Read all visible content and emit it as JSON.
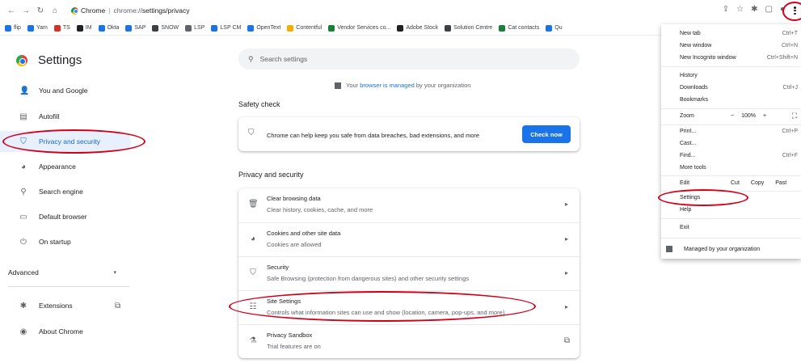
{
  "browser": {
    "tab_title": "Chrome",
    "url_host": "chrome://",
    "url_path": "settings/privacy",
    "icons": [
      "back-icon",
      "forward-icon",
      "reload-icon",
      "home-icon",
      "share-icon",
      "star-icon",
      "extensions-icon",
      "sidepanel-icon",
      "profile-icon",
      "kebab-icon"
    ]
  },
  "bookmarks": [
    {
      "label": "flip",
      "color": "#1a73e8"
    },
    {
      "label": "Yam",
      "color": "#1a73e8"
    },
    {
      "label": "TS",
      "color": "#d93025"
    },
    {
      "label": "IM",
      "color": "#202124"
    },
    {
      "label": "Okta",
      "color": "#1a73e8"
    },
    {
      "label": "SAP",
      "color": "#1a73e8"
    },
    {
      "label": "SNOW",
      "color": "#3c4043"
    },
    {
      "label": "LSP",
      "color": "#5f6368"
    },
    {
      "label": "LSP CM",
      "color": "#1a73e8"
    },
    {
      "label": "OpenText",
      "color": "#1a73e8"
    },
    {
      "label": "Contentful",
      "color": "#f9ab00"
    },
    {
      "label": "Vendor Services co...",
      "color": "#188038"
    },
    {
      "label": "Adobe Stock",
      "color": "#202124"
    },
    {
      "label": "Solution Centre",
      "color": "#3c4043"
    },
    {
      "label": "Cat contacts",
      "color": "#188038"
    },
    {
      "label": "Qu",
      "color": "#1a73e8"
    }
  ],
  "settings": {
    "title": "Settings",
    "nav": [
      {
        "label": "You and Google",
        "icon": "person-icon"
      },
      {
        "label": "Autofill",
        "icon": "clipboard-icon"
      },
      {
        "label": "Privacy and security",
        "icon": "shield-icon",
        "active": true
      },
      {
        "label": "Appearance",
        "icon": "palette-icon"
      },
      {
        "label": "Search engine",
        "icon": "search-icon"
      },
      {
        "label": "Default browser",
        "icon": "browser-icon"
      },
      {
        "label": "On startup",
        "icon": "power-icon"
      }
    ],
    "advanced": "Advanced",
    "extensions": "Extensions",
    "about": "About Chrome"
  },
  "main": {
    "search_placeholder": "Search settings",
    "managed_prefix": "Your",
    "managed_link": "browser is managed",
    "managed_suffix": "by your organization",
    "safety_title": "Safety check",
    "safety_text": "Chrome can help keep you safe from data breaches, bad extensions, and more",
    "check_now": "Check now",
    "privacy_title": "Privacy and security",
    "rows": [
      {
        "title": "Clear browsing data",
        "sub": "Clear history, cookies, cache, and more",
        "icon": "trash-icon"
      },
      {
        "title": "Cookies and other site data",
        "sub": "Cookies are allowed",
        "icon": "cookie-icon"
      },
      {
        "title": "Security",
        "sub": "Safe Browsing (protection from dangerous sites) and other security settings",
        "icon": "shield-icon"
      },
      {
        "title": "Site Settings",
        "sub": "Controls what information sites can use and show (location, camera, pop-ups, and more)",
        "icon": "sliders-icon"
      },
      {
        "title": "Privacy Sandbox",
        "sub": "Trial features are on",
        "icon": "flask-icon"
      }
    ]
  },
  "menu": {
    "new_tab": "New tab",
    "new_tab_sc": "Ctrl+T",
    "new_window": "New window",
    "new_window_sc": "Ctrl+N",
    "incognito": "New Incognito window",
    "incognito_sc": "Ctrl+Shift+N",
    "history": "History",
    "downloads": "Downloads",
    "downloads_sc": "Ctrl+J",
    "bookmarks": "Bookmarks",
    "zoom": "Zoom",
    "zoom_minus": "−",
    "zoom_value": "100%",
    "zoom_plus": "+",
    "print": "Print...",
    "print_sc": "Ctrl+P",
    "cast": "Cast...",
    "find": "Find...",
    "find_sc": "Ctrl+F",
    "more_tools": "More tools",
    "edit": "Edit",
    "cut": "Cut",
    "copy": "Copy",
    "paste": "Past",
    "settings": "Settings",
    "help": "Help",
    "exit": "Exit",
    "managed": "Managed by your organization"
  },
  "annotation_color": "#d0021b"
}
